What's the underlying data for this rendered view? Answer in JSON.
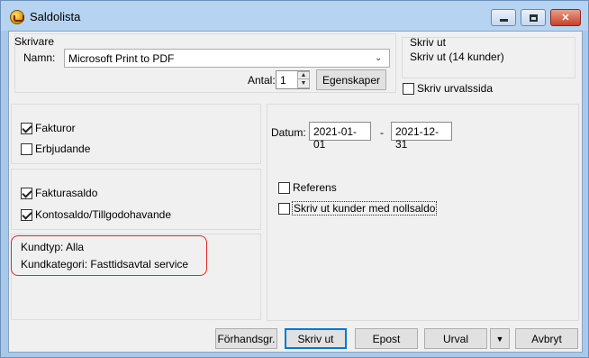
{
  "window": {
    "title": "Saldolista",
    "minimize_icon": "minimize-icon",
    "maximize_icon": "maximize-icon",
    "close_icon": "close-icon"
  },
  "printer": {
    "group_label": "Skrivare",
    "name_label": "Namn:",
    "name_value": "Microsoft Print to PDF",
    "count_label": "Antal:",
    "count_value": "1",
    "properties_button": "Egenskaper"
  },
  "print_info": {
    "group_label": "Skriv ut",
    "text": "Skriv ut (14 kunder)",
    "print_selection_page_label": "Skriv urvalssida",
    "print_selection_page_checked": false
  },
  "doc_types": {
    "invoices_label": "Fakturor",
    "invoices_checked": true,
    "offers_label": "Erbjudande",
    "offers_checked": false
  },
  "balances": {
    "invoice_balance_label": "Fakturasaldo",
    "invoice_balance_checked": true,
    "account_balance_label": "Kontosaldo/Tillgodohavande",
    "account_balance_checked": true
  },
  "filters": {
    "customer_type": "Kundtyp: Alla",
    "customer_category": "Kundkategori: Fasttidsavtal service"
  },
  "dates": {
    "label": "Datum:",
    "from": "2021-01-01",
    "separator": "-",
    "to": "2021-12-31"
  },
  "options": {
    "reference_label": "Referens",
    "reference_checked": false,
    "zero_balance_label": "Skriv ut kunder med nollsaldo",
    "zero_balance_checked": false
  },
  "buttons": {
    "preview": "Förhandsgr.",
    "print": "Skriv ut",
    "email": "Epost",
    "selection": "Urval",
    "dropdown_icon": "chevron-down-icon",
    "cancel": "Avbryt"
  }
}
